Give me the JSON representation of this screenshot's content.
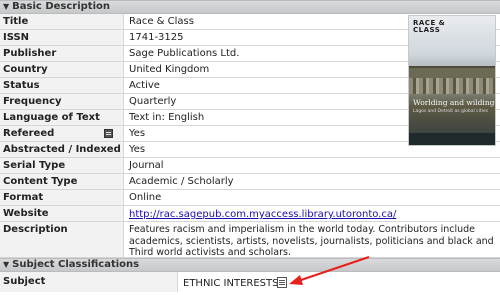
{
  "sections": {
    "basic": {
      "title": "Basic Description"
    },
    "subject": {
      "title": "Subject Classifications"
    }
  },
  "fields": {
    "title": {
      "label": "Title",
      "value": "Race & Class"
    },
    "issn": {
      "label": "ISSN",
      "value": "1741-3125"
    },
    "publisher": {
      "label": "Publisher",
      "value": "Sage Publications Ltd."
    },
    "country": {
      "label": "Country",
      "value": "United Kingdom"
    },
    "status": {
      "label": "Status",
      "value": "Active"
    },
    "frequency": {
      "label": "Frequency",
      "value": "Quarterly"
    },
    "language": {
      "label": "Language of Text",
      "value": "Text in: English"
    },
    "refereed": {
      "label": "Refereed",
      "value": "Yes"
    },
    "abstracted": {
      "label": "Abstracted / Indexed",
      "value": "Yes"
    },
    "serial_type": {
      "label": "Serial Type",
      "value": "Journal"
    },
    "content_type": {
      "label": "Content Type",
      "value": "Academic / Scholarly"
    },
    "format": {
      "label": "Format",
      "value": "Online"
    },
    "website": {
      "label": "Website",
      "value": "http://rac.sagepub.com.myaccess.library.utoronto.ca/"
    },
    "description": {
      "label": "Description",
      "value": "Features racism and imperialism in the world today. Contributors include academics, scientists, artists, novelists, journalists, politicians and black and Third world activists and scholars."
    },
    "subject": {
      "label": "Subject",
      "value": "ETHNIC INTERESTS"
    }
  },
  "cover": {
    "journal_title_line1": "RACE &",
    "journal_title_line2": "CLASS",
    "issue_title": "Worlding and wilding",
    "issue_subtitle": "Lagos and Detroit as global cities"
  },
  "colors": {
    "arrow": "#e8201c",
    "link": "#1a0dab",
    "header_bg": "#cfd1d3"
  },
  "icons": [
    "collapse-triangle-icon",
    "refereed-note-icon",
    "subject-doc-icon",
    "annotation-arrow"
  ]
}
